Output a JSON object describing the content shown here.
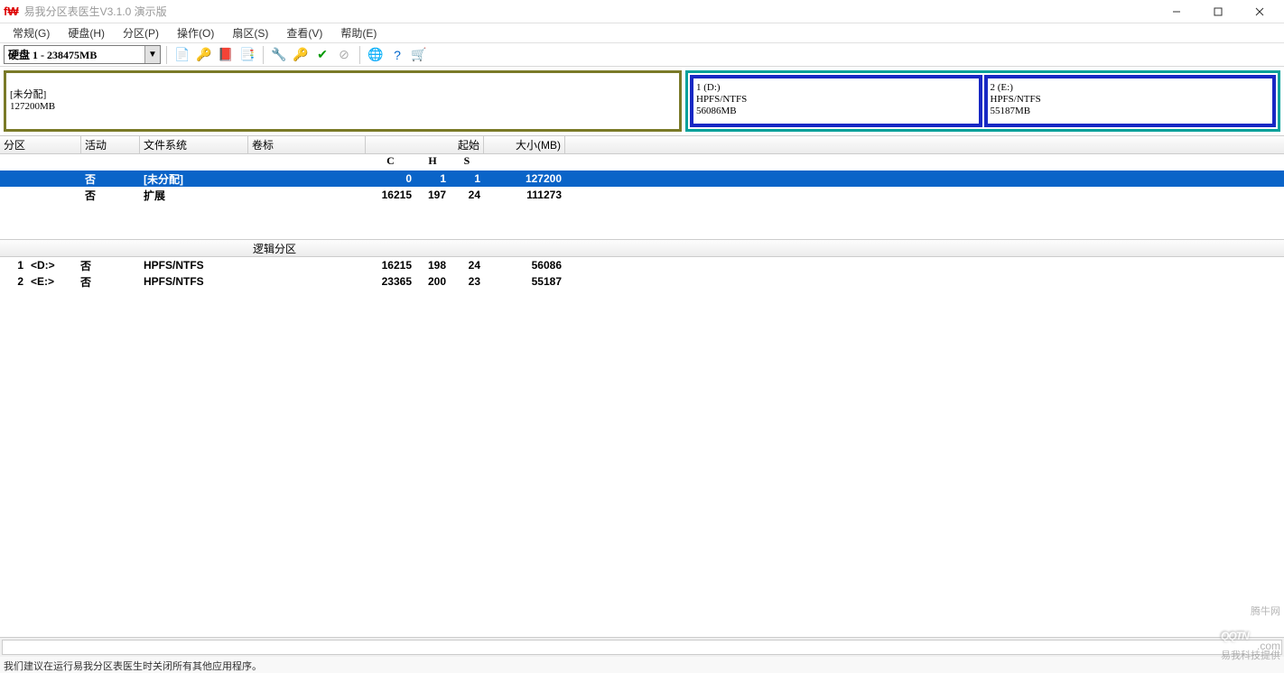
{
  "window": {
    "title": "易我分区表医生V3.1.0 演示版",
    "app_icon_text": "f₩"
  },
  "menus": [
    {
      "label": "常规(G)"
    },
    {
      "label": "硬盘(H)"
    },
    {
      "label": "分区(P)"
    },
    {
      "label": "操作(O)"
    },
    {
      "label": "扇区(S)"
    },
    {
      "label": "查看(V)"
    },
    {
      "label": "帮助(E)"
    }
  ],
  "toolbar": {
    "disk_selected": "硬盘 1 - 238475MB",
    "icons": [
      "page",
      "key-red",
      "disk",
      "page2",
      "sep",
      "wrench",
      "key",
      "check-green",
      "stop",
      "sep",
      "globe",
      "help",
      "cart"
    ]
  },
  "diskmap": {
    "unalloc": {
      "label": "[未分配]",
      "size": "127200MB"
    },
    "parts": [
      {
        "title": "1 (D:)",
        "fs": "HPFS/NTFS",
        "size": "56086MB"
      },
      {
        "title": "2 (E:)",
        "fs": "HPFS/NTFS",
        "size": "55187MB"
      }
    ]
  },
  "table": {
    "headers": {
      "partition": "分区",
      "active": "活动",
      "filesystem": "文件系统",
      "label": "卷标",
      "start": "起始",
      "size": "大小(MB)"
    },
    "sub": {
      "c": "C",
      "h": "H",
      "s": "S"
    },
    "rows": [
      {
        "act": "否",
        "fs": "[未分配]",
        "lbl": "",
        "c": "0",
        "h": "1",
        "s": "1",
        "size": "127200",
        "selected": true
      },
      {
        "act": "否",
        "fs": "扩展",
        "lbl": "",
        "c": "16215",
        "h": "197",
        "s": "24",
        "size": "111273",
        "selected": false
      }
    ],
    "logical_header": "逻辑分区",
    "logical_rows": [
      {
        "idx": "1",
        "drv": "<D:>",
        "act": "否",
        "fs": "HPFS/NTFS",
        "c": "16215",
        "h": "198",
        "s": "24",
        "size": "56086"
      },
      {
        "idx": "2",
        "drv": "<E:>",
        "act": "否",
        "fs": "HPFS/NTFS",
        "c": "23365",
        "h": "200",
        "s": "23",
        "size": "55187"
      }
    ]
  },
  "footer_hint": "我们建议在运行易我分区表医生时关闭所有其他应用程序。",
  "watermark": {
    "brand": "腾牛网",
    "domain": "QQTN",
    "sub": ".com",
    "slogan": "易我科技提供"
  }
}
